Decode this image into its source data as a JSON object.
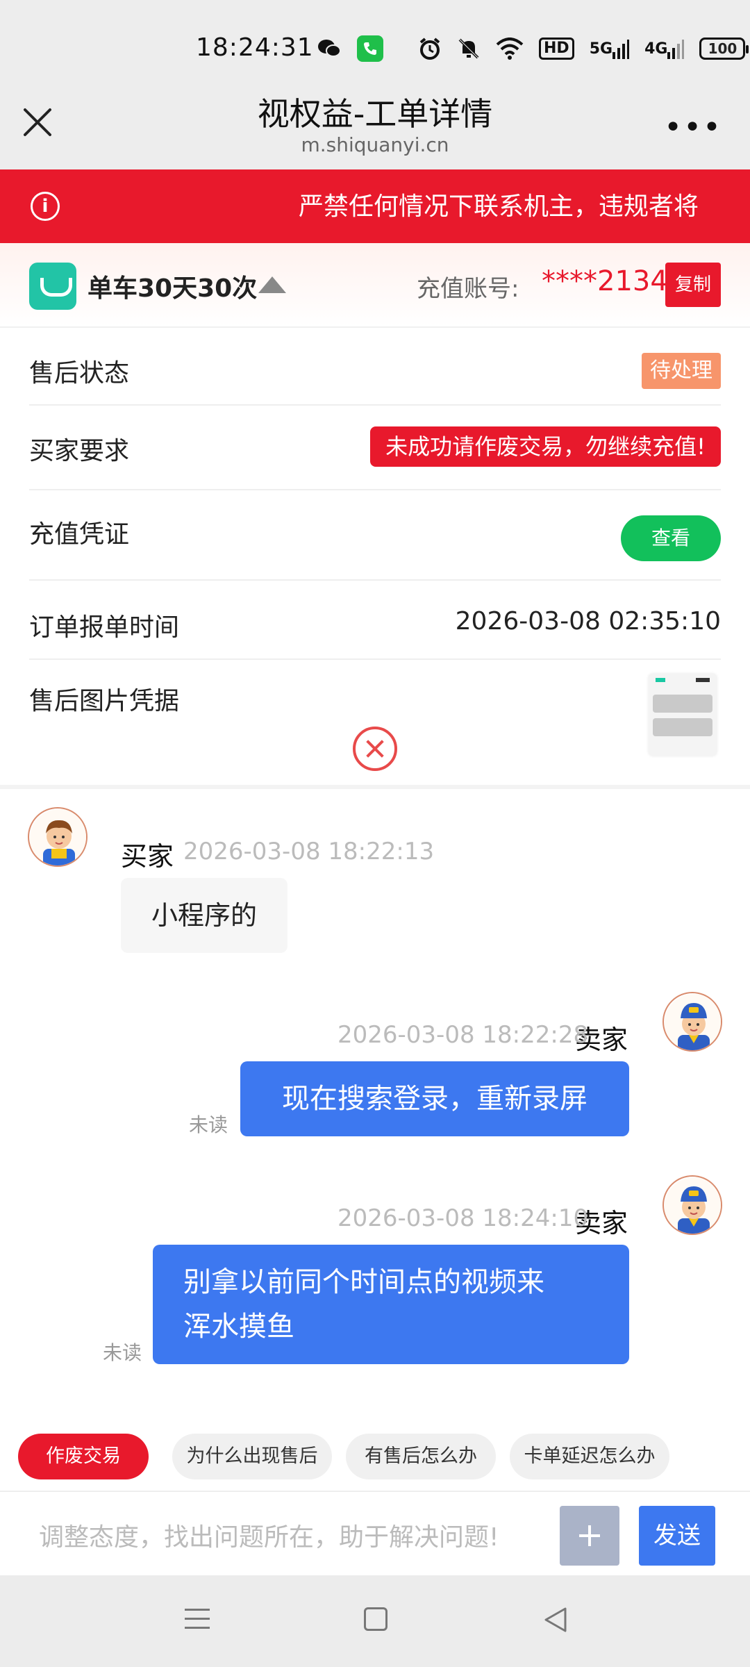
{
  "status_bar": {
    "time": "18:24:31",
    "hd_label": "HD",
    "net_5g": "5G",
    "net_4g": "4G",
    "battery": "100"
  },
  "nav": {
    "title": "视权益-工单详情",
    "domain": "m.shiquanyi.cn",
    "more": "•••"
  },
  "notice": {
    "icon": "i",
    "text": "严禁任何情况下联系机主，违规者将"
  },
  "product": {
    "name": "单车30天30次",
    "account_label": "充值账号:",
    "account_value": "****2134",
    "copy_label": "复制"
  },
  "info": {
    "status_label": "售后状态",
    "status_value": "待处理",
    "requirement_label": "买家要求",
    "requirement_value": "未成功请作废交易，勿继续充值!",
    "voucher_label": "充值凭证",
    "voucher_button": "查看",
    "order_time_label": "订单报单时间",
    "order_time_value": "2026-03-08 02:35:10",
    "image_label": "售后图片凭据"
  },
  "chat": [
    {
      "role": "买家",
      "time": "2026-03-08 18:22:13",
      "text": "小程序的"
    },
    {
      "role": "卖家",
      "time": "2026-03-08 18:22:28",
      "text": "现在搜索登录，重新录屏",
      "status": "未读"
    },
    {
      "role": "卖家",
      "time": "2026-03-08 18:24:10",
      "text_line1": "别拿以前同个时间点的视频来",
      "text_line2": "浑水摸鱼",
      "status": "未读"
    }
  ],
  "quick_replies": [
    "作废交易",
    "为什么出现售后",
    "有售后怎么办",
    "卡单延迟怎么办"
  ],
  "composer": {
    "placeholder": "调整态度，找出问题所在，助于解决问题!",
    "send_label": "发送"
  },
  "colors": {
    "brand_red": "#e8192c",
    "chat_blue": "#3d78f0",
    "green": "#12c05b",
    "badge_orange": "#f7956b"
  },
  "icons": [
    "close-icon",
    "more-icon",
    "info-icon",
    "bike-logo-icon",
    "caret-up-icon",
    "remove-icon",
    "plus-icon",
    "menu-icon",
    "home-icon",
    "back-icon"
  ]
}
